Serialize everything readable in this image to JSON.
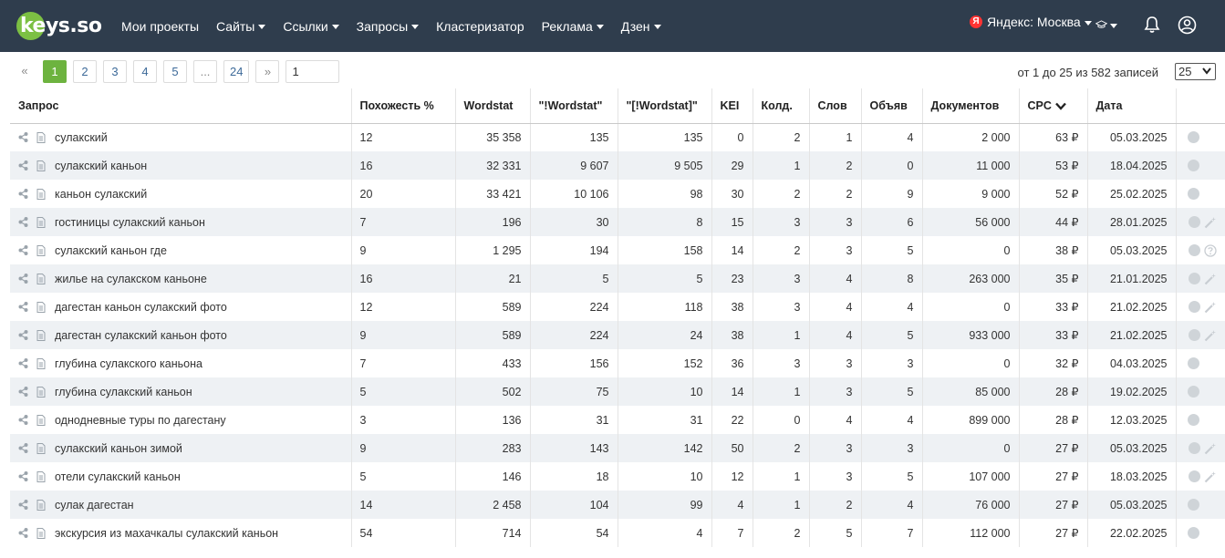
{
  "brand": {
    "logo_text": "keys.so",
    "accent": "#7cc043",
    "header_bg": "#2f3d4d"
  },
  "nav": [
    {
      "label": "Мои проекты",
      "dropdown": false
    },
    {
      "label": "Сайты",
      "dropdown": true
    },
    {
      "label": "Ссылки",
      "dropdown": true
    },
    {
      "label": "Запросы",
      "dropdown": true
    },
    {
      "label": "Кластеризатор",
      "dropdown": false
    },
    {
      "label": "Реклама",
      "dropdown": true
    },
    {
      "label": "Дзен",
      "dropdown": true
    }
  ],
  "header": {
    "region_label": "Яндекс: Москва",
    "region_badge": "Я"
  },
  "pagination": {
    "prev": "«",
    "pages": [
      "1",
      "2",
      "3",
      "4",
      "5",
      "...",
      "24"
    ],
    "active": "1",
    "next": "»",
    "goto_value": "1",
    "records_text": "от 1 до 25 из 582 записей",
    "per_page": "25"
  },
  "table": {
    "columns": [
      "Запрос",
      "Похожесть %",
      "Wordstat",
      "\"!Wordstat\"",
      "\"[!Wordstat]\"",
      "KEI",
      "Колд.",
      "Слов",
      "Объяв",
      "Документов",
      "CPC",
      "Дата"
    ],
    "sorted_column": "CPC",
    "rows": [
      {
        "q": "сулакский",
        "sim": "12",
        "ws": "35 358",
        "ews": "135",
        "bws": "135",
        "kei": "0",
        "kold": "2",
        "words": "1",
        "ads": "4",
        "docs": "2 000",
        "cpc": "63 ₽",
        "date": "05.03.2025",
        "icons": [
          "globe"
        ]
      },
      {
        "q": "сулакский каньон",
        "sim": "16",
        "ws": "32 331",
        "ews": "9 607",
        "bws": "9 505",
        "kei": "29",
        "kold": "1",
        "words": "2",
        "ads": "0",
        "docs": "11 000",
        "cpc": "53 ₽",
        "date": "18.04.2025",
        "icons": [
          "globe"
        ]
      },
      {
        "q": "каньон сулакский",
        "sim": "20",
        "ws": "33 421",
        "ews": "10 106",
        "bws": "98",
        "kei": "30",
        "kold": "2",
        "words": "2",
        "ads": "9",
        "docs": "9 000",
        "cpc": "52 ₽",
        "date": "25.02.2025",
        "icons": [
          "globe"
        ]
      },
      {
        "q": "гостиницы сулакский каньон",
        "sim": "7",
        "ws": "196",
        "ews": "30",
        "bws": "8",
        "kei": "15",
        "kold": "3",
        "words": "3",
        "ads": "6",
        "docs": "56 000",
        "cpc": "44 ₽",
        "date": "28.01.2025",
        "icons": [
          "globe",
          "wand"
        ]
      },
      {
        "q": "сулакский каньон где",
        "sim": "9",
        "ws": "1 295",
        "ews": "194",
        "bws": "158",
        "kei": "14",
        "kold": "2",
        "words": "3",
        "ads": "5",
        "docs": "0",
        "cpc": "38 ₽",
        "date": "05.03.2025",
        "icons": [
          "globe",
          "question"
        ]
      },
      {
        "q": "жилье на сулакском каньоне",
        "sim": "16",
        "ws": "21",
        "ews": "5",
        "bws": "5",
        "kei": "23",
        "kold": "3",
        "words": "4",
        "ads": "8",
        "docs": "263 000",
        "cpc": "35 ₽",
        "date": "21.01.2025",
        "icons": [
          "globe",
          "wand"
        ]
      },
      {
        "q": "дагестан каньон сулакский фото",
        "sim": "12",
        "ws": "589",
        "ews": "224",
        "bws": "118",
        "kei": "38",
        "kold": "3",
        "words": "4",
        "ads": "4",
        "docs": "0",
        "cpc": "33 ₽",
        "date": "21.02.2025",
        "icons": [
          "globe",
          "wand"
        ]
      },
      {
        "q": "дагестан сулакский каньон фото",
        "sim": "9",
        "ws": "589",
        "ews": "224",
        "bws": "24",
        "kei": "38",
        "kold": "1",
        "words": "4",
        "ads": "5",
        "docs": "933 000",
        "cpc": "33 ₽",
        "date": "21.02.2025",
        "icons": [
          "globe",
          "wand"
        ]
      },
      {
        "q": "глубина сулакского каньона",
        "sim": "7",
        "ws": "433",
        "ews": "156",
        "bws": "152",
        "kei": "36",
        "kold": "3",
        "words": "3",
        "ads": "3",
        "docs": "0",
        "cpc": "32 ₽",
        "date": "04.03.2025",
        "icons": [
          "globe"
        ]
      },
      {
        "q": "глубина сулакский каньон",
        "sim": "5",
        "ws": "502",
        "ews": "75",
        "bws": "10",
        "kei": "14",
        "kold": "1",
        "words": "3",
        "ads": "5",
        "docs": "85 000",
        "cpc": "28 ₽",
        "date": "19.02.2025",
        "icons": [
          "globe"
        ]
      },
      {
        "q": "однодневные туры по дагестану",
        "sim": "3",
        "ws": "136",
        "ews": "31",
        "bws": "31",
        "kei": "22",
        "kold": "0",
        "words": "4",
        "ads": "4",
        "docs": "899 000",
        "cpc": "28 ₽",
        "date": "12.03.2025",
        "icons": [
          "globe"
        ]
      },
      {
        "q": "сулакский каньон зимой",
        "sim": "9",
        "ws": "283",
        "ews": "143",
        "bws": "142",
        "kei": "50",
        "kold": "2",
        "words": "3",
        "ads": "3",
        "docs": "0",
        "cpc": "27 ₽",
        "date": "05.03.2025",
        "icons": [
          "globe",
          "wand"
        ]
      },
      {
        "q": "отели сулакский каньон",
        "sim": "5",
        "ws": "146",
        "ews": "18",
        "bws": "10",
        "kei": "12",
        "kold": "1",
        "words": "3",
        "ads": "5",
        "docs": "107 000",
        "cpc": "27 ₽",
        "date": "18.03.2025",
        "icons": [
          "globe",
          "wand"
        ]
      },
      {
        "q": "сулак дагестан",
        "sim": "14",
        "ws": "2 458",
        "ews": "104",
        "bws": "99",
        "kei": "4",
        "kold": "1",
        "words": "2",
        "ads": "4",
        "docs": "76 000",
        "cpc": "27 ₽",
        "date": "05.03.2025",
        "icons": [
          "globe"
        ]
      },
      {
        "q": "экскурсия из махачкалы сулакский каньон",
        "sim": "54",
        "ws": "714",
        "ews": "54",
        "bws": "4",
        "kei": "7",
        "kold": "2",
        "words": "5",
        "ads": "7",
        "docs": "112 000",
        "cpc": "27 ₽",
        "date": "22.02.2025",
        "icons": [
          "globe"
        ]
      }
    ]
  }
}
